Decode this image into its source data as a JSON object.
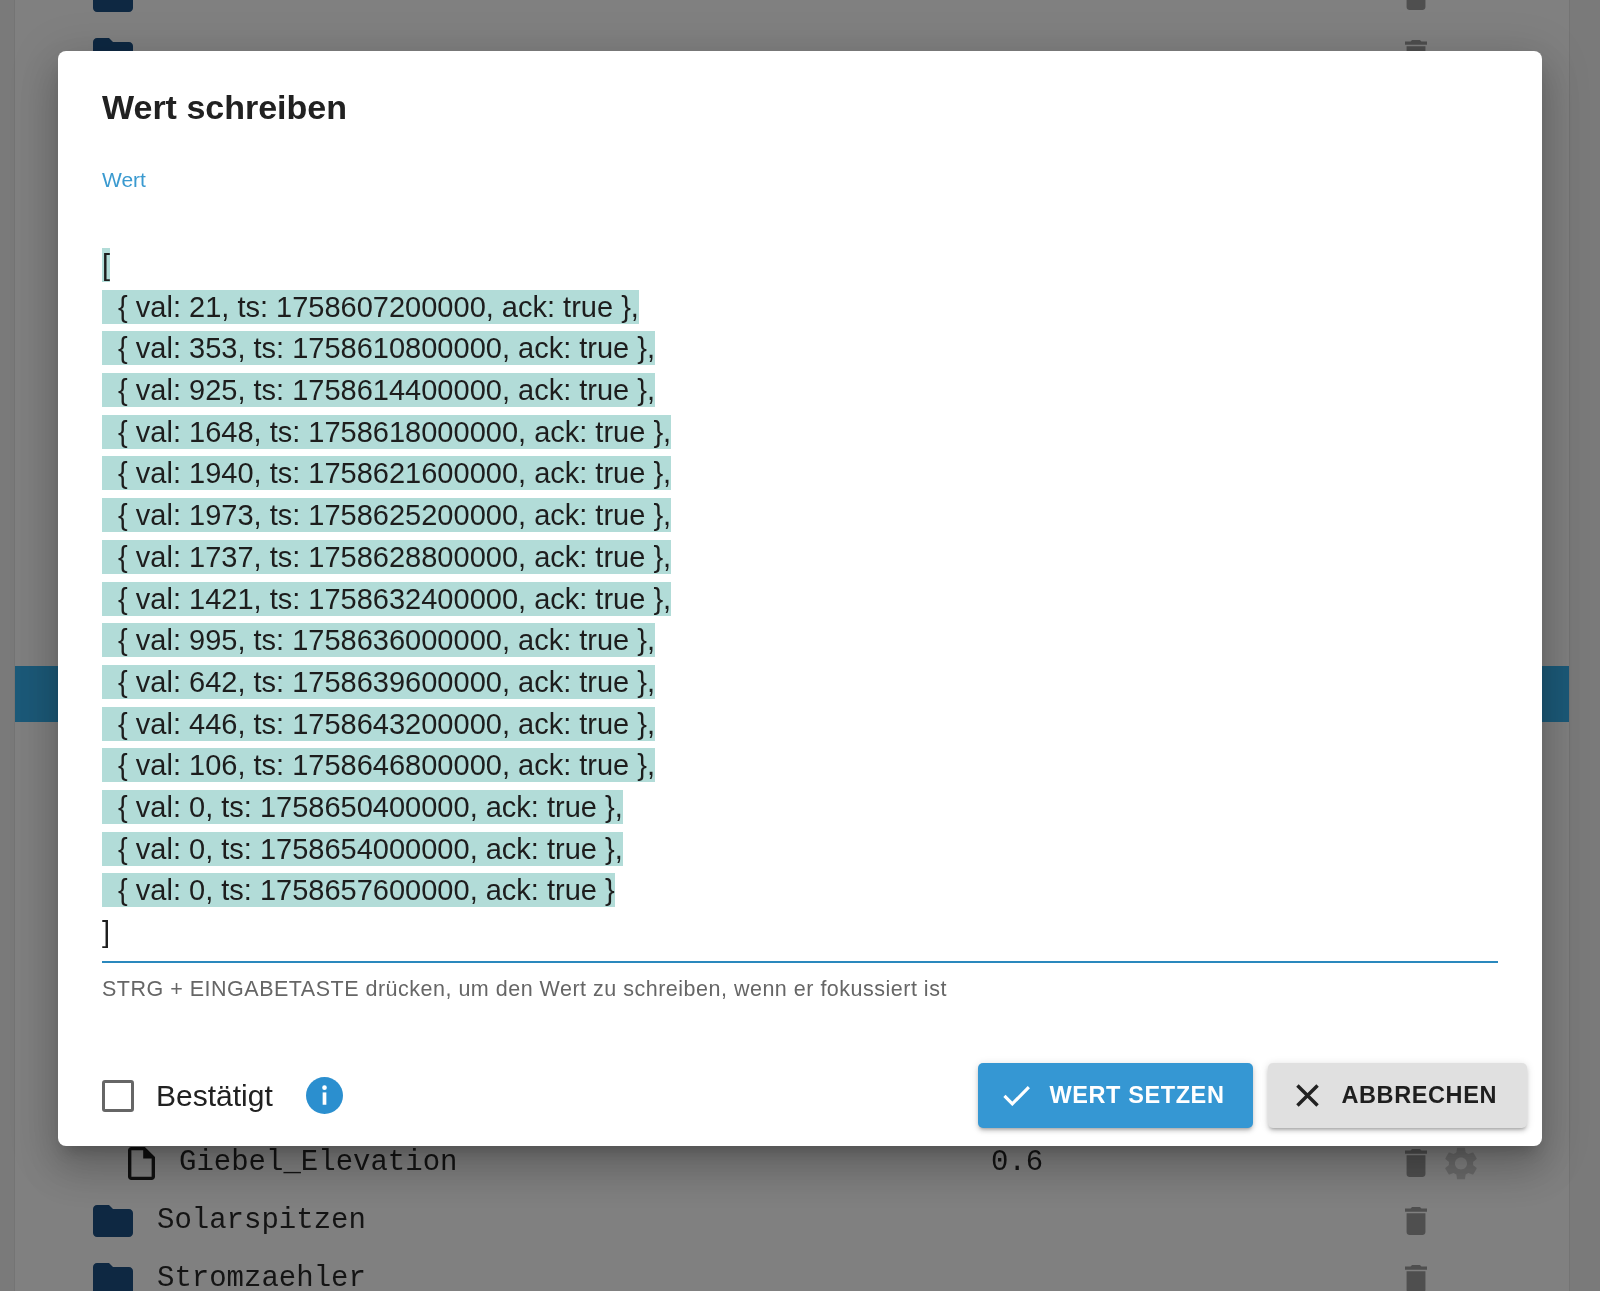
{
  "object_tree": {
    "top_rows": [
      {
        "kind": "folder"
      },
      {
        "kind": "folder"
      }
    ],
    "bottom_rows": [
      {
        "kind": "state",
        "name": "Giebel_Elevation",
        "value": "0.6"
      },
      {
        "kind": "folder",
        "name": "Solarspitzen"
      },
      {
        "kind": "folder",
        "name": "Stromzaehler"
      }
    ]
  },
  "dialog": {
    "title": "Wert schreiben",
    "value_field": {
      "label": "Wert",
      "lines": [
        {
          "text": "[",
          "selected": true
        },
        {
          "text": "  { val: 21, ts: 1758607200000, ack: true },",
          "selected": true
        },
        {
          "text": "  { val: 353, ts: 1758610800000, ack: true },",
          "selected": true
        },
        {
          "text": "  { val: 925, ts: 1758614400000, ack: true },",
          "selected": true
        },
        {
          "text": "  { val: 1648, ts: 1758618000000, ack: true },",
          "selected": true
        },
        {
          "text": "  { val: 1940, ts: 1758621600000, ack: true },",
          "selected": true
        },
        {
          "text": "  { val: 1973, ts: 1758625200000, ack: true },",
          "selected": true
        },
        {
          "text": "  { val: 1737, ts: 1758628800000, ack: true },",
          "selected": true
        },
        {
          "text": "  { val: 1421, ts: 1758632400000, ack: true },",
          "selected": true
        },
        {
          "text": "  { val: 995, ts: 1758636000000, ack: true },",
          "selected": true
        },
        {
          "text": "  { val: 642, ts: 1758639600000, ack: true },",
          "selected": true
        },
        {
          "text": "  { val: 446, ts: 1758643200000, ack: true },",
          "selected": true
        },
        {
          "text": "  { val: 106, ts: 1758646800000, ack: true },",
          "selected": true
        },
        {
          "text": "  { val: 0, ts: 1758650400000, ack: true },",
          "selected": true
        },
        {
          "text": "  { val: 0, ts: 1758654000000, ack: true },",
          "selected": true
        },
        {
          "text": "  { val: 0, ts: 1758657600000, ack: true }",
          "selected": true
        },
        {
          "text": "]",
          "selected": false
        }
      ],
      "helper_text": "STRG + EINGABETASTE drücken, um den Wert zu schreiben, wenn er fokussiert ist"
    },
    "confirmed_checkbox": {
      "label": "Bestätigt",
      "checked": false
    },
    "buttons": [
      {
        "kind": "primary",
        "label": "WERT SETZEN"
      },
      {
        "kind": "secondary",
        "label": "ABBRECHEN"
      }
    ]
  }
}
